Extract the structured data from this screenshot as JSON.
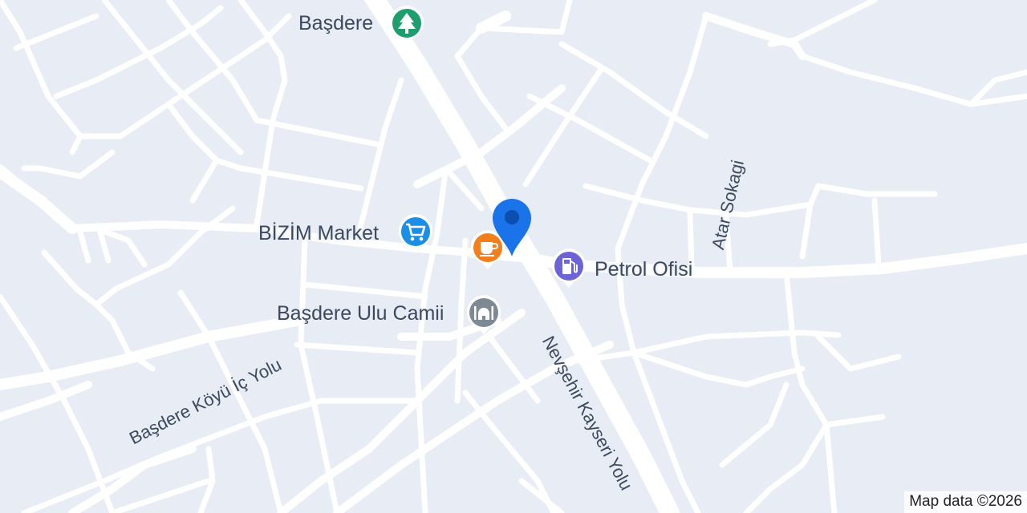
{
  "map": {
    "background_color": "#e8ecf4",
    "road_color": "#ffffff",
    "label_color": "#3c4a60"
  },
  "pois": [
    {
      "id": "basdere-park",
      "label": "Başdere",
      "category": "park",
      "icon": "tree-icon",
      "color": "#1e9e6f"
    },
    {
      "id": "bizim-market",
      "label": "BİZİM Market",
      "category": "shopping",
      "icon": "shopping-cart-icon",
      "color": "#1b8fe6"
    },
    {
      "id": "cafe",
      "label": "",
      "category": "cafe",
      "icon": "coffee-cup-icon",
      "color": "#f27f1b"
    },
    {
      "id": "petrol-ofisi",
      "label": "Petrol Ofisi",
      "category": "gas-station",
      "icon": "fuel-pump-icon",
      "color": "#6b63d6"
    },
    {
      "id": "basdere-ulu-camii",
      "label": "Başdere Ulu Camii",
      "category": "mosque",
      "icon": "mosque-icon",
      "color": "#7d8a96"
    }
  ],
  "streets": [
    {
      "id": "nevsehir-kayseri-yolu",
      "label": "Nevşehir Kayseri Yolu"
    },
    {
      "id": "basdere-koyu-ic-yolu",
      "label": "Başdere Köyü İç Yolu"
    },
    {
      "id": "atar-sokagi",
      "label": "Atar Sokagi"
    }
  ],
  "location_pin": {
    "icon": "location-pin-icon",
    "color": "#1a73e8"
  },
  "attribution": "Map data ©2026"
}
